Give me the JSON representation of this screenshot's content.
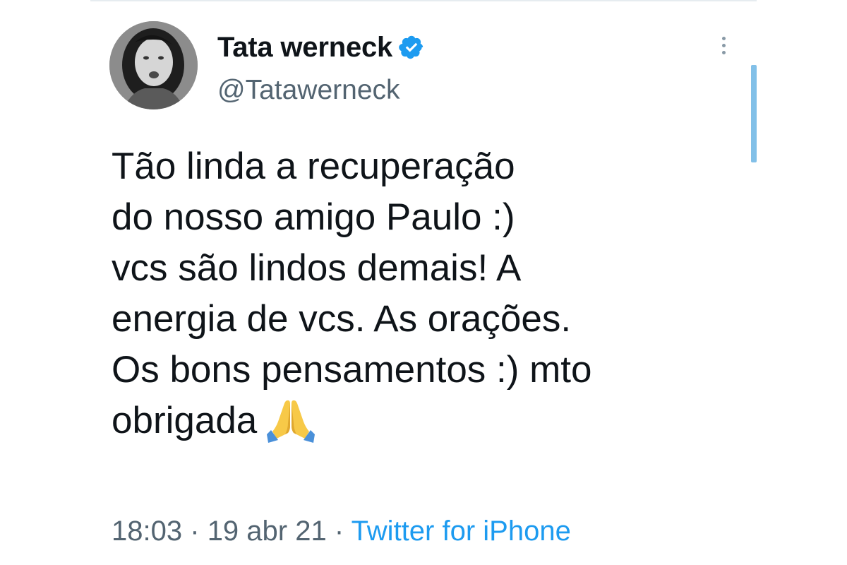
{
  "tweet": {
    "author": {
      "display_name": "Tata werneck",
      "handle": "@Tatawerneck",
      "verified": true,
      "avatar_style": "grayscale-photo"
    },
    "text_lines": [
      "Tão linda a recuperação",
      "do nosso amigo Paulo :)",
      "vcs são lindos demais! A",
      "energia de vcs. As orações.",
      "Os bons pensamentos :) mto",
      "obrigada"
    ],
    "emoji": "folded-hands",
    "time": "18:03",
    "date": "19 abr 21",
    "separator": "·",
    "source": "Twitter for iPhone"
  },
  "icons": {
    "verified": "verified-badge-icon",
    "more": "more-options-icon"
  },
  "colors": {
    "text": "#0f1419",
    "secondary": "#536471",
    "link": "#1d9bf0",
    "verified": "#1d9bf0",
    "scrollbar": "#82c0e8"
  }
}
